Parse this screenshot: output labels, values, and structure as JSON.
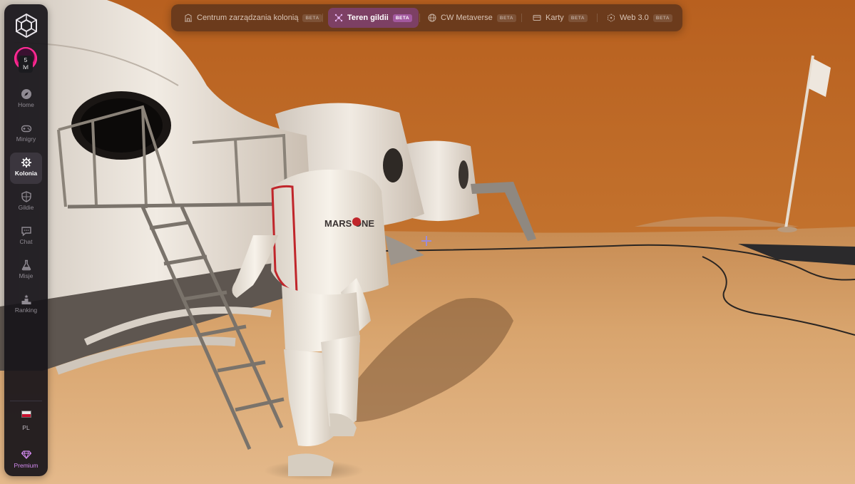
{
  "app": {
    "accent": "#ff2d95",
    "premium_color": "#d38af0"
  },
  "user": {
    "level_value": "5",
    "level_unit": "lvl"
  },
  "sidebar": {
    "items": [
      {
        "label": "Home",
        "icon": "compass-icon"
      },
      {
        "label": "Minigry",
        "icon": "gamepad-icon"
      },
      {
        "label": "Kolonia",
        "icon": "colony-gear-icon",
        "active": true
      },
      {
        "label": "Gildie",
        "icon": "shield-icon"
      },
      {
        "label": "Chat",
        "icon": "chat-bubble-icon"
      },
      {
        "label": "Misje",
        "icon": "flask-icon"
      },
      {
        "label": "Ranking",
        "icon": "podium-icon"
      }
    ],
    "language": "PL",
    "premium": "Premium"
  },
  "topnav": {
    "tabs": [
      {
        "label": "Centrum zarządzania kolonią",
        "badge": "BETA",
        "icon": "building-icon"
      },
      {
        "label": "Teren gildii",
        "badge": "BETA",
        "icon": "guild-terrain-icon",
        "active": true
      },
      {
        "label": "CW Metaverse",
        "badge": "BETA",
        "icon": "globe-icon"
      },
      {
        "label": "Karty",
        "badge": "BETA",
        "icon": "cards-icon"
      },
      {
        "label": "Web 3.0",
        "badge": "BETA",
        "icon": "cube-network-icon"
      }
    ]
  },
  "scene": {
    "backpack_logo": "MARS ONE"
  }
}
